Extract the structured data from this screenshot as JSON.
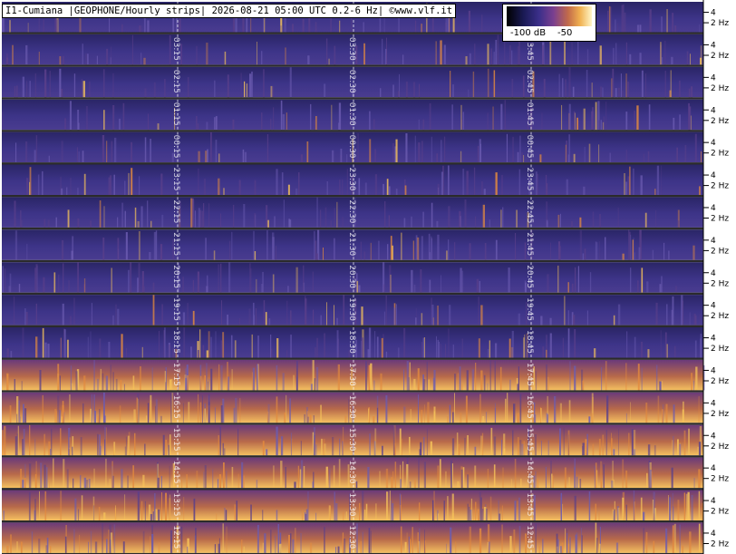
{
  "title": "I1-Cumiana |GEOPHONE/Hourly strips| 2026-08-21 05:00 UTC 0.2-6 Hz| ©www.vlf.it",
  "colorbar": {
    "min_label": "-100 dB",
    "max_label": "-50",
    "colors": [
      "#000000",
      "#1a1a55",
      "#3b2f8a",
      "#7a3f8f",
      "#c26a4a",
      "#f0b050",
      "#fff6c8"
    ]
  },
  "chart_data": {
    "type": "heatmap",
    "y_ticks": [
      {
        "value": 4,
        "label": "4"
      },
      {
        "value": 2,
        "label": "2 Hz"
      }
    ],
    "freq_range": [
      0.2,
      6
    ],
    "strips": [
      {
        "hour": "04",
        "marks": [
          "04",
          "04",
          ""
        ],
        "intensity": 0.35
      },
      {
        "hour": "03",
        "marks": [
          "03:15",
          "03:30",
          "03:45"
        ],
        "intensity": 0.3
      },
      {
        "hour": "02",
        "marks": [
          "02:15",
          "02:30",
          "02:45"
        ],
        "intensity": 0.3
      },
      {
        "hour": "01",
        "marks": [
          "01:15",
          "01:30",
          "01:45"
        ],
        "intensity": 0.28
      },
      {
        "hour": "00",
        "marks": [
          "00:15",
          "00:30",
          "00:45"
        ],
        "intensity": 0.3
      },
      {
        "hour": "23",
        "marks": [
          "23:15",
          "23:30",
          "23:45"
        ],
        "intensity": 0.3
      },
      {
        "hour": "22",
        "marks": [
          "22:15",
          "22:30",
          "22:45"
        ],
        "intensity": 0.35
      },
      {
        "hour": "21",
        "marks": [
          "21:15",
          "21:30",
          "21:45"
        ],
        "intensity": 0.35
      },
      {
        "hour": "20",
        "marks": [
          "20:15",
          "20:30",
          "20:45"
        ],
        "intensity": 0.32
      },
      {
        "hour": "19",
        "marks": [
          "19:15",
          "19:30",
          "19:45"
        ],
        "intensity": 0.3
      },
      {
        "hour": "18",
        "marks": [
          "18:15",
          "18:30",
          "18:45"
        ],
        "intensity": 0.55
      },
      {
        "hour": "17",
        "marks": [
          "17:15",
          "17:30",
          "17:45"
        ],
        "intensity": 0.7
      },
      {
        "hour": "16",
        "marks": [
          "16:15",
          "16:30",
          "16:45"
        ],
        "intensity": 0.75
      },
      {
        "hour": "15",
        "marks": [
          "15:15",
          "15:30",
          "15:45"
        ],
        "intensity": 0.8
      },
      {
        "hour": "14",
        "marks": [
          "14:15",
          "14:30",
          "14:45"
        ],
        "intensity": 0.78
      },
      {
        "hour": "13",
        "marks": [
          "13:15",
          "13:30",
          "13:45"
        ],
        "intensity": 0.78
      },
      {
        "hour": "12",
        "marks": [
          "12:15",
          "12:30",
          "12:45"
        ],
        "intensity": 0.75
      }
    ]
  }
}
